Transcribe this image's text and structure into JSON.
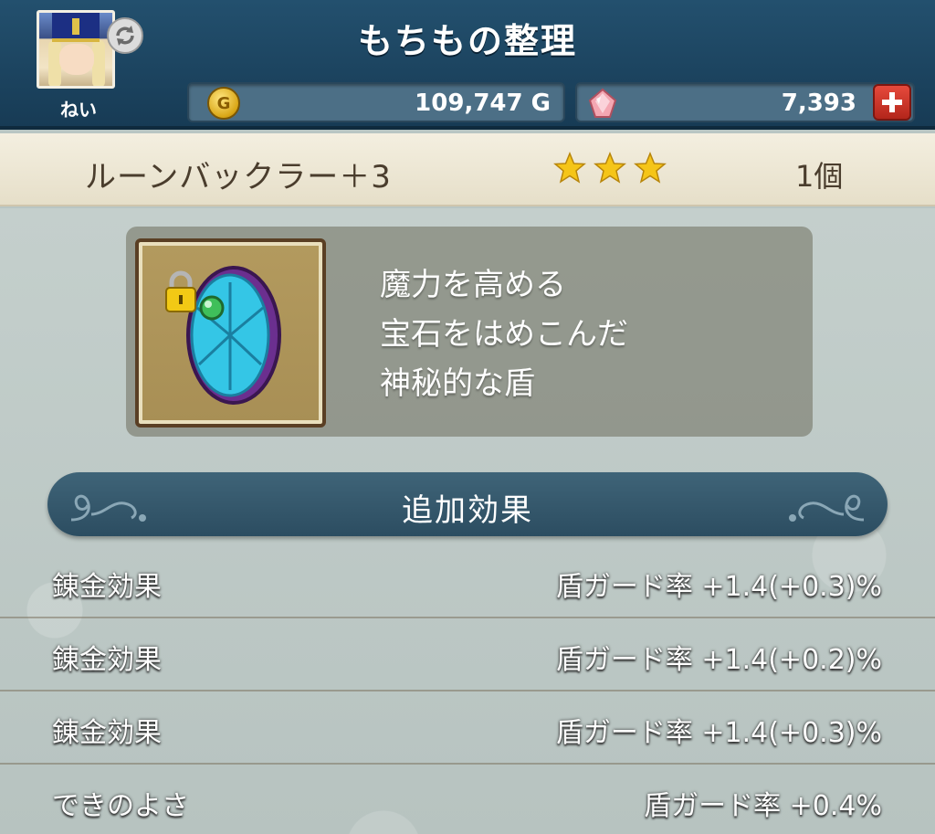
{
  "header": {
    "title": "もちもの整理",
    "player_name": "ねい",
    "gold": "109,747 G",
    "gems": "7,393",
    "gold_icon": "gold-coin-icon",
    "gem_icon": "gem-icon",
    "add_icon": "plus-icon",
    "refresh_icon": "refresh-icon"
  },
  "item": {
    "name": "ルーンバックラー＋3",
    "stars": 3,
    "count": "1個",
    "icon": "rune-buckler-shield-icon",
    "locked": true,
    "description": [
      "魔力を高める",
      "宝石をはめこんだ",
      "神秘的な盾"
    ]
  },
  "effects": {
    "section_title": "追加効果",
    "rows": [
      {
        "label": "錬金効果",
        "value": "盾ガード率 +1.4(+0.3)%"
      },
      {
        "label": "錬金効果",
        "value": "盾ガード率 +1.4(+0.2)%"
      },
      {
        "label": "錬金効果",
        "value": "盾ガード率 +1.4(+0.3)%"
      },
      {
        "label": "できのよさ",
        "value": "盾ガード率 +0.4%"
      }
    ]
  },
  "colors": {
    "header_bg": "#1d4560",
    "title_bar_bg": "#efe9d8",
    "accent_red": "#d0342a",
    "star_gold": "#f5c518"
  }
}
